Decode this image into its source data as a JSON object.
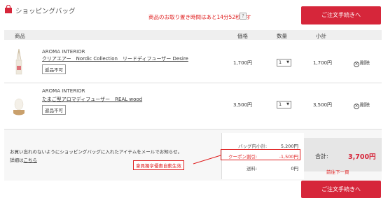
{
  "header": {
    "title": "ショッピングバッグ",
    "hold_notice": "商品のお取り置き時間はあと14分52秒です",
    "help_glyph": "?",
    "checkout_label": "ご注文手続きへ"
  },
  "table": {
    "headers": {
      "product": "商品",
      "price": "価格",
      "qty": "数量",
      "subtotal": "小計"
    },
    "items": [
      {
        "brand": "AROMA INTERIOR",
        "name": "クリアエアー　Nordic Collection　リードディフューザー Desire",
        "badge": "返品不可",
        "price": "1,700円",
        "qty": "1",
        "subtotal": "1,700円",
        "remove": "削除"
      },
      {
        "brand": "AROMA INTERIOR",
        "name": "たまご型アロマディフューザー　REAL wood",
        "badge": "返品不可",
        "price": "3,500円",
        "qty": "1",
        "subtotal": "3,500円",
        "remove": "削除"
      }
    ]
  },
  "summary": {
    "note1": "お買い忘れのないようにショッピングバッグに入れたアイテムをメールでお知らせ。",
    "note2_prefix": "詳細は",
    "note2_link": "こちら",
    "bag_subtotal_label": "バッグ内小計:",
    "bag_subtotal_value": "5,200円",
    "coupon_label": "クーポン割引:",
    "coupon_value": "-1,500円",
    "shipping_label": "送料:",
    "shipping_value": "0円",
    "total_label": "合計:",
    "total_value": "3,700円"
  },
  "annotations": {
    "coupon_note": "會員獨享優惠自動生效",
    "next_page": "前往下一頁"
  },
  "colors": {
    "accent": "#d6263a",
    "annotation": "#e02020"
  }
}
